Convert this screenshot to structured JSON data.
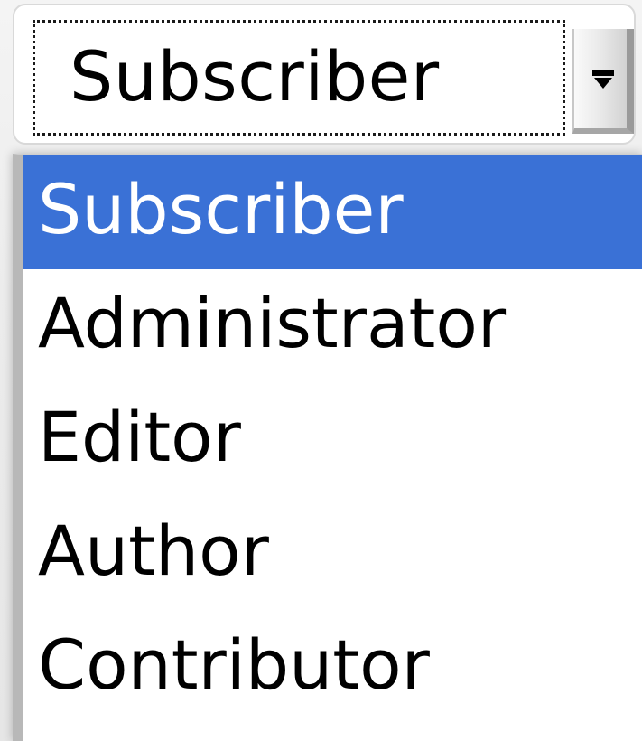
{
  "select": {
    "value": "Subscriber",
    "arrow_icon": "chevron-down-icon"
  },
  "dropdown": {
    "selected_index": 0,
    "selected_color": "#3a71d6",
    "options": [
      {
        "label": "Subscriber"
      },
      {
        "label": "Administrator"
      },
      {
        "label": "Editor"
      },
      {
        "label": "Author"
      },
      {
        "label": "Contributor"
      }
    ]
  }
}
